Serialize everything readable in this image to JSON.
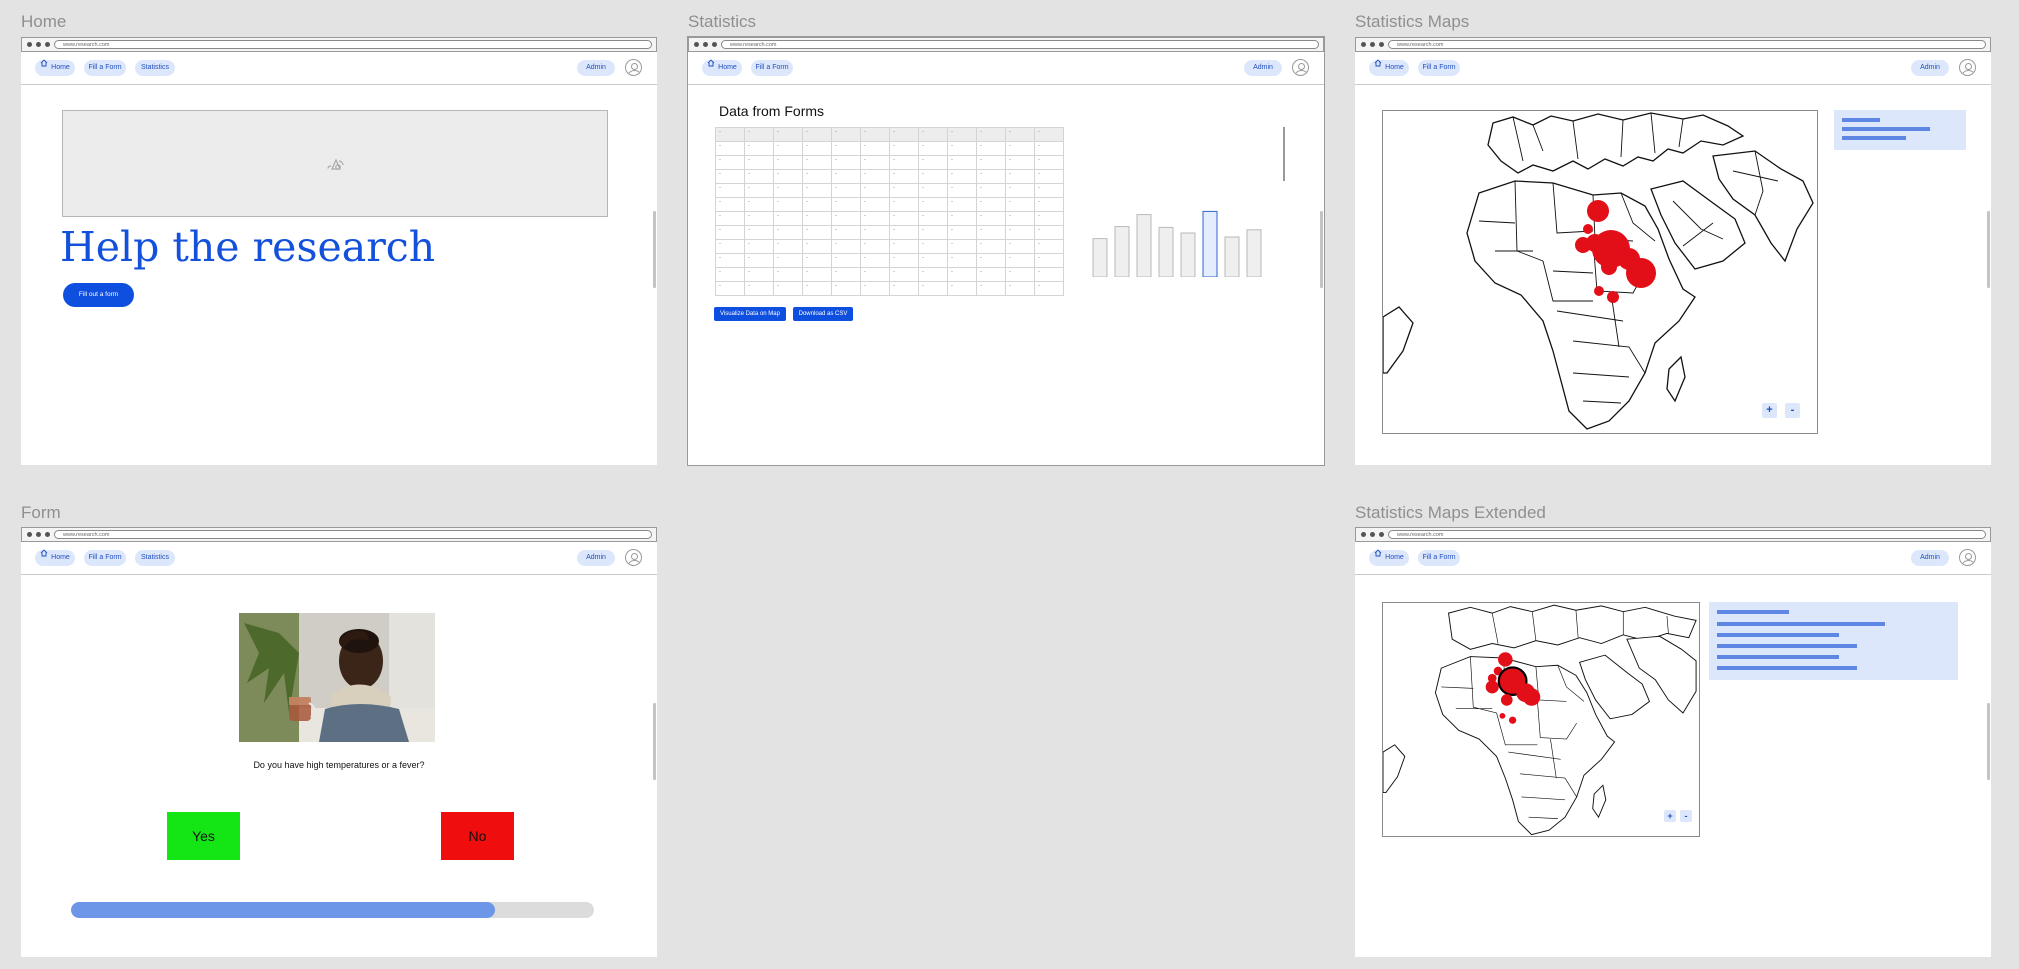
{
  "frames": {
    "home": "Home",
    "statistics": "Statistics",
    "maps": "Statistics Maps",
    "form": "Form",
    "maps_extended": "Statistics Maps Extended"
  },
  "browser": {
    "url": "www.research.com"
  },
  "nav": {
    "home": "Home",
    "fill_form": "Fill a Form",
    "statistics": "Statistics",
    "admin": "Admin"
  },
  "home": {
    "headline": "Help the research",
    "cta": "Fill out a form"
  },
  "statistics": {
    "title": "Data from Forms",
    "visualize_button": "Visualize Data on Map",
    "download_button": "Download as CSV",
    "cell": "-",
    "table_rows": 12,
    "table_cols": 12,
    "bar_values": [
      0.48,
      0.63,
      0.78,
      0.62,
      0.55,
      0.82,
      0.5,
      0.59
    ],
    "highlight_index": 5
  },
  "form": {
    "question": "Do you have high temperatures or a fever?",
    "yes": "Yes",
    "no": "No",
    "progress": 0.81,
    "colors": {
      "yes": "#13e614",
      "no": "#ef0d0d",
      "progress": "#6d96e9"
    }
  },
  "maps": {
    "zoom_in": "+",
    "zoom_out": "-"
  },
  "icons": [
    "home-icon",
    "user-icon",
    "image-placeholder-icon"
  ]
}
